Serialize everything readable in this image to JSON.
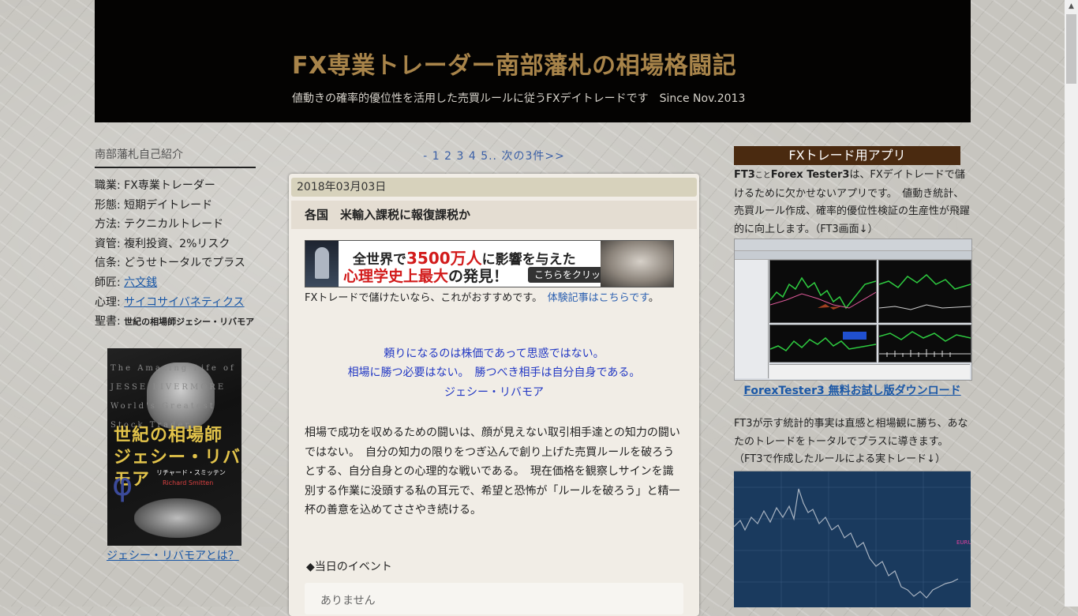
{
  "header": {
    "title": "FX専業トレーダー南部藩札の相場格闘記",
    "description": "値動きの確率的優位性を活用した売買ルールに従うFXデイトレードです　Since Nov.2013"
  },
  "left_sidebar": {
    "title": "南部藩札自己紹介",
    "profile": [
      {
        "label": "職業: ",
        "value": "FX専業トレーダー"
      },
      {
        "label": "形態: ",
        "value": "短期デイトレード"
      },
      {
        "label": "方法: ",
        "value": "テクニカルトレード"
      },
      {
        "label": "資管: ",
        "value": "複利投資、2%リスク"
      },
      {
        "label": "信条: ",
        "value": "どうせトータルでプラス"
      },
      {
        "label": "師匠: ",
        "value": "六文銭"
      },
      {
        "label": "心理: ",
        "value": "サイコサイバネティクス"
      },
      {
        "label": "聖書: ",
        "value": "世紀の相場師ジェシー・リバモア"
      }
    ],
    "book": {
      "title_line1": "世紀の相場師",
      "title_line2": "ジェシー・リバモア",
      "author": "リチャード・スミッテン",
      "author_en": "Richard Smitten",
      "ghost_text": "The Amazing Life of JESSE LIVERMORE World's Greatest Stock Trader"
    },
    "book_link": "ジェシー・リバモアとは？"
  },
  "pager": {
    "prefix": "-",
    "pages": [
      "1",
      "2",
      "3",
      "4",
      "5.."
    ],
    "next": "次の3件>>"
  },
  "post": {
    "date": "2018年03月03日",
    "title": "各国　米輸入課税に報復課税か",
    "banner": {
      "line1_a": "全世界で",
      "line1_b": "3500万人",
      "line1_c": "に影響を与えた",
      "line2_a": "心理学史上最大",
      "line2_b": "の発見！",
      "button": "こちらをクリック"
    },
    "ad_text": "FXトレードで儲けたいなら、これがおすすめです。　",
    "ad_link": "体験記事はこちらです",
    "ad_end": "。",
    "quote": [
      "頼りになるのは株価であって思惑ではない。",
      "相場に勝つ必要はない。　勝つべき相手は自分自身である。",
      "ジェシー・リバモア"
    ],
    "paragraph": "相場で成功を収めるための闘いは、顔が見えない取引相手達との知力の闘いではない。　自分の知力の限りをつぎ込んで創り上げた売買ルールを破ろうとする、自分自身との心理的な戦いである。　現在価格を観察しサインを識別する作業に没頭する私の耳元で、希望と恐怖が「ルールを破ろう」と精一杯の善意を込めてささやき続ける。",
    "events_heading": "◆当日のイベント",
    "events_value": "ありません"
  },
  "right_sidebar": {
    "title": "FXトレード用アプリ",
    "intro_b1": "FT3",
    "intro_s": "こと",
    "intro_b2": "Forex Tester3",
    "intro_rest": "は、FXデイトレードで儲けるために欠かせないアプリです。　値動き統計、売買ルール作成、確率的優位性検証の生産性が飛躍的に向上します。（FT3画面↓）",
    "download_link": "ForexTester3 無料お試し版ダウンロード",
    "text2": "FT3が示す統計的事実は直感と相場観に勝ち、あなたのトレードをトータルでプラスに導きます。　（FT3で作成したルールによる実トレード↓）"
  },
  "colors": {
    "header_bg": "#040302",
    "title_gold": "#a8844a",
    "link_blue": "#1a57a6",
    "quote_blue": "#2238c4",
    "app_title_bg": "#4a2a10"
  },
  "icons": [
    "scroll-up-arrow-icon"
  ]
}
